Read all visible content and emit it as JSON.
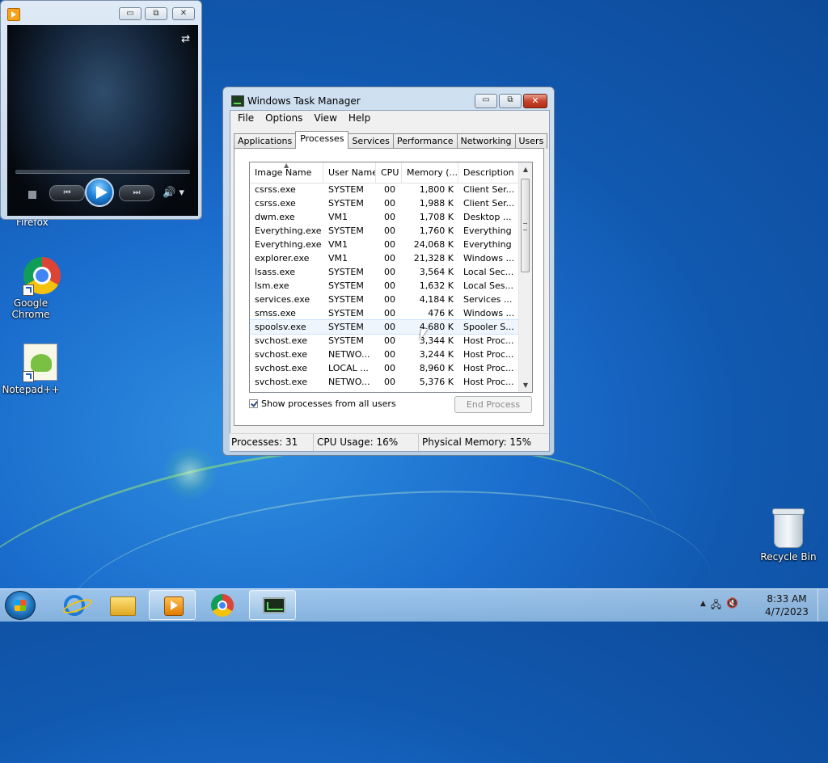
{
  "desktop": {
    "icons": [
      {
        "label": "Firefox"
      },
      {
        "label": "Google Chrome"
      },
      {
        "label": "Notepad++"
      },
      {
        "label": "Recycle Bin"
      }
    ]
  },
  "media_player": {
    "title_buttons": {
      "minimize": "▭",
      "restore": "⧉",
      "close": "✕"
    },
    "controls": {
      "prev": "⏮",
      "next": "⏭",
      "volume": "🔊 ▾"
    },
    "swap_icon": "⇄"
  },
  "task_manager": {
    "title": "Windows Task Manager",
    "menu": [
      "File",
      "Options",
      "View",
      "Help"
    ],
    "tabs": [
      "Applications",
      "Processes",
      "Services",
      "Performance",
      "Networking",
      "Users"
    ],
    "active_tab": "Processes",
    "columns": [
      "Image Name",
      "User Name",
      "CPU",
      "Memory (...",
      "Description"
    ],
    "processes": [
      {
        "name": "csrss.exe",
        "user": "SYSTEM",
        "cpu": "00",
        "mem": "1,800 K",
        "desc": "Client Ser..."
      },
      {
        "name": "csrss.exe",
        "user": "SYSTEM",
        "cpu": "00",
        "mem": "1,988 K",
        "desc": "Client Ser..."
      },
      {
        "name": "dwm.exe",
        "user": "VM1",
        "cpu": "00",
        "mem": "1,708 K",
        "desc": "Desktop ..."
      },
      {
        "name": "Everything.exe",
        "user": "SYSTEM",
        "cpu": "00",
        "mem": "1,760 K",
        "desc": "Everything"
      },
      {
        "name": "Everything.exe",
        "user": "VM1",
        "cpu": "00",
        "mem": "24,068 K",
        "desc": "Everything"
      },
      {
        "name": "explorer.exe",
        "user": "VM1",
        "cpu": "00",
        "mem": "21,328 K",
        "desc": "Windows ..."
      },
      {
        "name": "lsass.exe",
        "user": "SYSTEM",
        "cpu": "00",
        "mem": "3,564 K",
        "desc": "Local Sec..."
      },
      {
        "name": "lsm.exe",
        "user": "SYSTEM",
        "cpu": "00",
        "mem": "1,632 K",
        "desc": "Local Ses..."
      },
      {
        "name": "services.exe",
        "user": "SYSTEM",
        "cpu": "00",
        "mem": "4,184 K",
        "desc": "Services ..."
      },
      {
        "name": "smss.exe",
        "user": "SYSTEM",
        "cpu": "00",
        "mem": "476 K",
        "desc": "Windows ..."
      },
      {
        "name": "spoolsv.exe",
        "user": "SYSTEM",
        "cpu": "00",
        "mem": "4,680 K",
        "desc": "Spooler S..."
      },
      {
        "name": "svchost.exe",
        "user": "SYSTEM",
        "cpu": "00",
        "mem": "3,344 K",
        "desc": "Host Proc..."
      },
      {
        "name": "svchost.exe",
        "user": "NETWO...",
        "cpu": "00",
        "mem": "3,244 K",
        "desc": "Host Proc..."
      },
      {
        "name": "svchost.exe",
        "user": "LOCAL ...",
        "cpu": "00",
        "mem": "8,960 K",
        "desc": "Host Proc..."
      },
      {
        "name": "svchost.exe",
        "user": "NETWO...",
        "cpu": "00",
        "mem": "5,376 K",
        "desc": "Host Proc..."
      }
    ],
    "show_all_label": "Show processes from all users",
    "show_all_checked": true,
    "end_process_label": "End Process",
    "status": {
      "processes": "Processes: 31",
      "cpu": "CPU Usage: 16%",
      "memory": "Physical Memory: 15%"
    }
  },
  "taskbar": {
    "clock_time": "8:33 AM",
    "clock_date": "4/7/2023",
    "tray": {
      "chevron": "▲",
      "network": "🖧",
      "volume": "🔇"
    }
  }
}
